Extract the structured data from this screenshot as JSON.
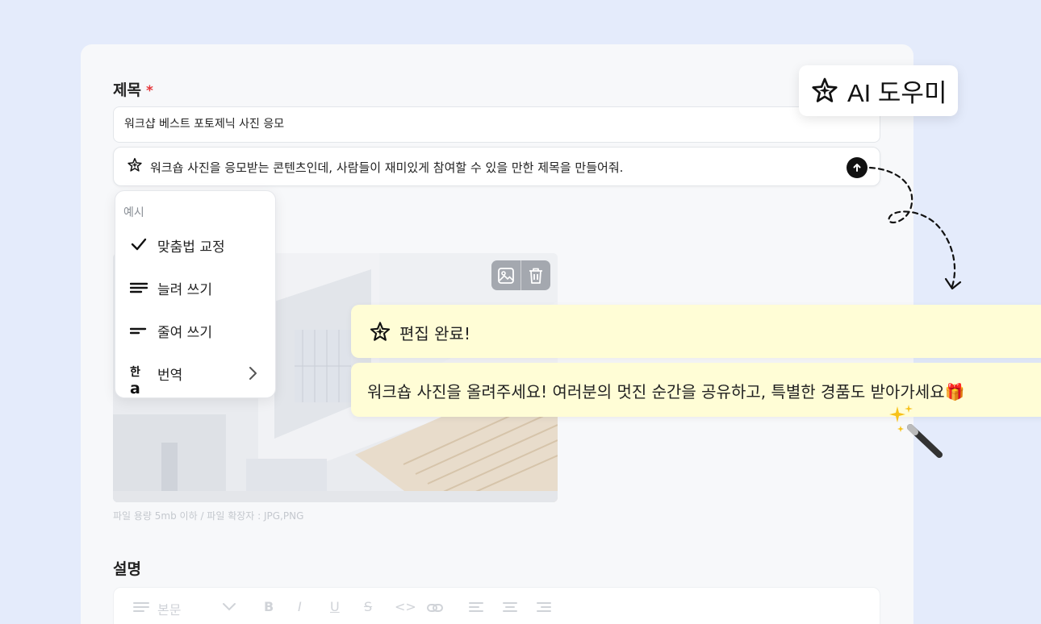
{
  "form": {
    "title_label": "제목",
    "required_mark": "*",
    "title_value": "워크샵 베스트 포토제닉 사진 응모",
    "prompt_text": "워크숍 사진을 응모받는 콘텐츠인데, 사람들이 재미있게 참여할 수 있을 만한 제목을 만들어줘.",
    "file_hint": "파일 용량 5mb 이하 / 파일 확장자 : JPG,PNG",
    "description_label": "설명"
  },
  "ai_badge": {
    "label": "AI 도우미",
    "icon": "sparkle-star-icon"
  },
  "menu": {
    "header": "예시",
    "items": [
      {
        "label": "맞춤법 교정",
        "icon": "check-icon"
      },
      {
        "label": "늘려 쓰기",
        "icon": "lines-long-icon"
      },
      {
        "label": "줄여 쓰기",
        "icon": "lines-short-icon"
      },
      {
        "label": "번역",
        "icon": "translate-icon",
        "icon_text_ko": "한",
        "icon_text_en": "a"
      }
    ]
  },
  "result": {
    "status": "편집 완료!",
    "suggestion": "워크숍 사진을 올려주세요! 여러분의 멋진 순간을 공유하고, 특별한 경품도 받아가세요🎁"
  },
  "editor_toolbar": {
    "style_select": "본문",
    "buttons": [
      "B",
      "I",
      "U",
      "S",
      "<>",
      "link"
    ]
  },
  "colors": {
    "background": "#e4ebfb",
    "card": "#f7f8fa",
    "bubble": "#fffdd6",
    "required": "#e5363a"
  }
}
